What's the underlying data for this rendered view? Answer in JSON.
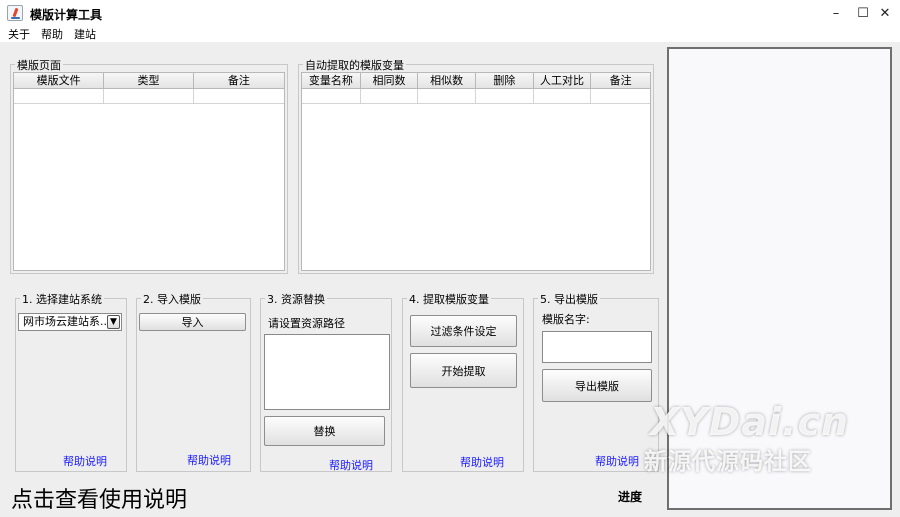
{
  "window": {
    "title": "模版计算工具",
    "minimize": "–",
    "maximize": "☐",
    "close": "✕"
  },
  "menu": [
    "关于",
    "帮助",
    "建站"
  ],
  "template_page": {
    "title": "模版页面",
    "columns": [
      "模版文件",
      "类型",
      "备注"
    ]
  },
  "variables": {
    "title": "自动提取的模版变量",
    "columns": [
      "变量名称",
      "相同数",
      "相似数",
      "删除",
      "人工对比",
      "备注"
    ]
  },
  "step1": {
    "title": "1. 选择建站系统",
    "selected": "网市场云建站系...",
    "help": "帮助说明"
  },
  "step2": {
    "title": "2. 导入模版",
    "import_button": "导入",
    "help": "帮助说明"
  },
  "step3": {
    "title": "3. 资源替换",
    "prompt": "请设置资源路径",
    "replace_button": "替换",
    "help": "帮助说明"
  },
  "step4": {
    "title": "4. 提取模版变量",
    "filter_button": "过滤条件设定",
    "start_button": "开始提取",
    "help": "帮助说明"
  },
  "step5": {
    "title": "5. 导出模版",
    "name_label": "模版名字:",
    "export_button": "导出模版",
    "help": "帮助说明"
  },
  "footer": {
    "usage_link": "点击查看使用说明",
    "progress_label": "进度"
  },
  "watermark": {
    "line1": "XYDai.cn",
    "line2": "新源代源码社区"
  },
  "colors": {
    "link": "#1a1aff",
    "panel_border": "#6f6f6f",
    "background": "#eeeeee"
  }
}
